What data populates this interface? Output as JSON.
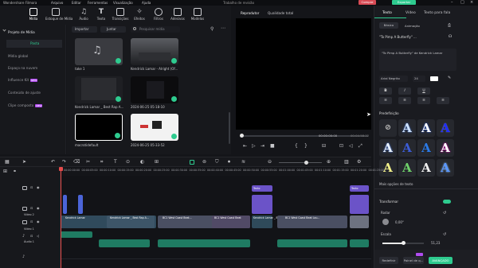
{
  "titlebar": {
    "title": "Wondershare Filmora",
    "menus": [
      "Arquivo",
      "Editar",
      "Ferramentas",
      "Visualização",
      "Ajuda"
    ],
    "project_name": "Trabalho de revisão",
    "upgrade_label": "Compre",
    "export_label": "Exportar"
  },
  "toolbar": {
    "tools": [
      {
        "label": "Mídia",
        "icon": "media-icon"
      },
      {
        "label": "Estoque de Mídia",
        "icon": "stock-media-icon"
      },
      {
        "label": "Áudio",
        "icon": "audio-icon"
      },
      {
        "label": "Texto",
        "icon": "text-icon"
      },
      {
        "label": "Transições",
        "icon": "transitions-icon"
      },
      {
        "label": "Efeitos",
        "icon": "effects-icon"
      },
      {
        "label": "Filtros",
        "icon": "filters-icon"
      },
      {
        "label": "Adesivos",
        "icon": "stickers-icon"
      },
      {
        "label": "Modelos",
        "icon": "templates-icon"
      }
    ]
  },
  "sidebar": {
    "items": [
      {
        "label": "Projeto de Mídia"
      },
      {
        "label": "Pasta"
      },
      {
        "label": "Mídia global"
      },
      {
        "label": "Espaço na nuvem"
      },
      {
        "label": "Influence Kit",
        "badge": "NEW"
      },
      {
        "label": "Conteúdo de ajuste"
      },
      {
        "label": "Clipe composto",
        "badge": "NEW"
      }
    ]
  },
  "media": {
    "import_label": "Importar",
    "sort_label": "Juntar",
    "search_placeholder": "Pesquisar mídia",
    "items": [
      {
        "caption": "take 1"
      },
      {
        "caption": "Kendrick Lamar - Alright (Of..."
      },
      {
        "caption": "Kendrick Lamar _ Best Rap A..."
      },
      {
        "caption": "2024-06-25 05-18-10"
      },
      {
        "caption": "macrotidefault"
      },
      {
        "caption": "2024-06-25 05-33-52"
      }
    ]
  },
  "player": {
    "tab_player": "Reprodutor",
    "tab_quality": "Qualidade total",
    "time_current": "00:00:00:00",
    "time_total": "00:04:58:22"
  },
  "right_panel": {
    "tabs": [
      "Texto",
      "Vídeo",
      "Texto para fala"
    ],
    "subtabs": [
      "Básico",
      "Animação"
    ],
    "clip_title": "\"To Pimp A Butterfly\" ...",
    "text_content": "\"To Pimp A Butterfly\" de Kendrick Lamar",
    "font": "Arial Negrito",
    "font_size": "24",
    "presets_label": "Predefinição",
    "more_options_label": "Mais opções de texto",
    "transform_label": "Transformar",
    "rotate_label": "Rodar",
    "rotate_value": "0,00°",
    "scale_label": "Escala",
    "scale_value": "51,23",
    "scale_fraction": 0.5123,
    "reset_label": "Redefinir",
    "keyframe_label": "Painel de q...",
    "advanced_label": "AVANÇADO",
    "preset_letter": "A",
    "accent": "#2ecb8f",
    "ai_badge": "#b14cf0"
  },
  "timeline": {
    "ruler": [
      "00:00:00:00",
      "00:00:05:00",
      "00:00:10:00",
      "00:00:15:00",
      "00:00:20:00",
      "00:00:25:00",
      "00:00:30:00",
      "00:00:35:00",
      "00:00:40:00",
      "00:00:45:00",
      "00:00:50:00",
      "00:00:55:00",
      "00:01:00:00",
      "00:01:05:00",
      "00:01:10:00",
      "00:01:15:00",
      "00:01:20:00",
      "00:01:25:00"
    ],
    "track_labels": [
      "Vídeo 3",
      "Vídeo 2",
      "Vídeo 1",
      "Áudio 1"
    ],
    "clip_labels": [
      "Kendrick Lamar",
      "Kendrick Lamar _ Best Rap A...",
      "BC1 West Coast Beat...",
      "BC1 West Coast Beat",
      "Kendrick Lamar _ Best...",
      "BC1 West Coast Beat Lou..."
    ],
    "title_clip_label": "Texto"
  }
}
